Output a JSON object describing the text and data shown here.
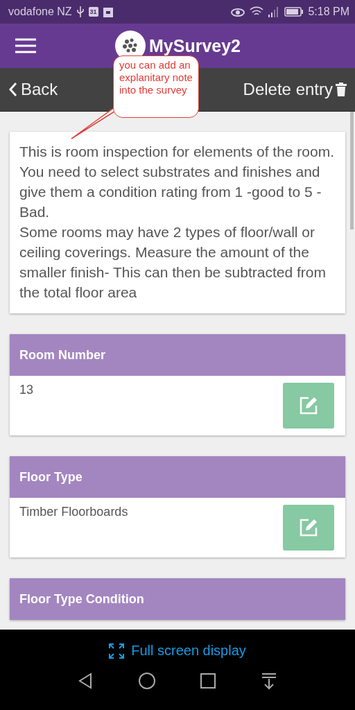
{
  "status_bar": {
    "carrier": "vodafone NZ",
    "calendar_day": "31",
    "time": "5:18 PM"
  },
  "app_bar": {
    "title": "MySurvey2"
  },
  "sub_bar": {
    "back": "Back",
    "delete": "Delete entry"
  },
  "callout": {
    "text": "you can add an explanitary note into the survey"
  },
  "description": [
    "This is room inspection for elements of the room. You need to select substrates and finishes and give them a condition rating from 1 -good to 5 -Bad.",
    "Some rooms may have 2 types of floor/wall or ceiling coverings. Measure the amount of the smaller finish- This can then be subtracted from the total floor area"
  ],
  "fields": [
    {
      "label": "Room Number",
      "value": "13"
    },
    {
      "label": "Floor Type",
      "value": "Timber Floorboards"
    },
    {
      "label": "Floor Type Condition"
    }
  ],
  "fullscreen_prompt": {
    "label": "Full screen display"
  }
}
